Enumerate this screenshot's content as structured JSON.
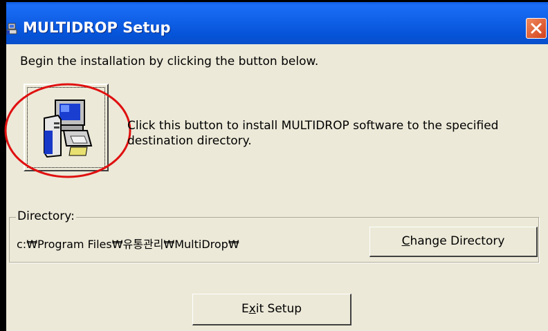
{
  "window": {
    "title": "MULTIDROP Setup",
    "title_icon": "setup-computer-icon",
    "close_icon": "close-icon"
  },
  "instruction": "Begin the installation by clicking the button below.",
  "install": {
    "button_icon": "computer-install-icon",
    "description": "Click this button to install MULTIDROP software to the specified destination directory."
  },
  "directory": {
    "group_label": "Directory:",
    "path": "c:₩Program Files₩유통관리₩MultiDrop₩",
    "change_button": {
      "prefix": "",
      "mnemonic": "C",
      "rest": "hange Directory"
    }
  },
  "exit_button": {
    "prefix": "E",
    "mnemonic": "x",
    "rest": "it Setup"
  },
  "colors": {
    "titlebar": "#0553d7",
    "face": "#ece9d8",
    "close": "#d2401b",
    "annotation_circle": "#e01010"
  }
}
